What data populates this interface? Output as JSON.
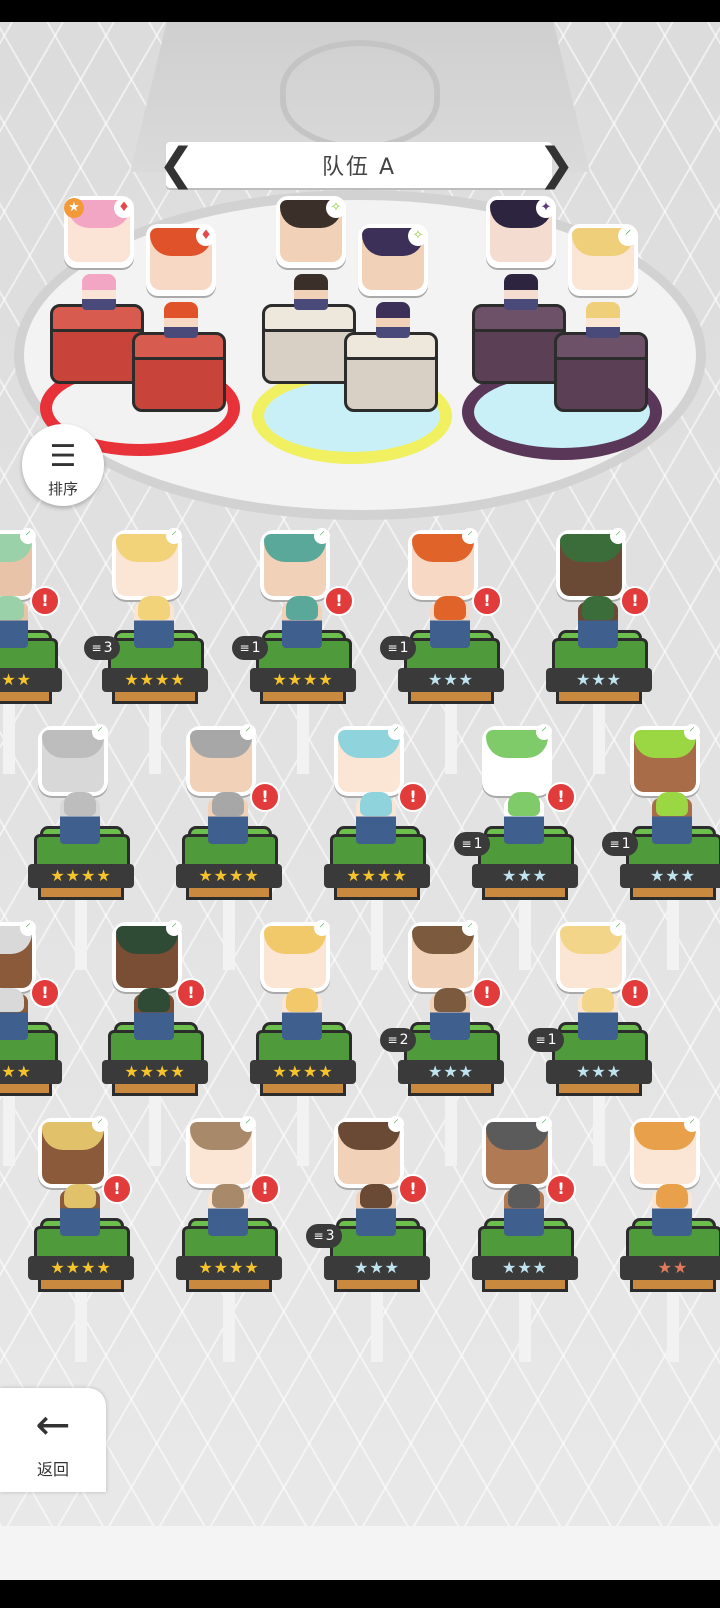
{
  "header": {
    "team_label": "队伍 A"
  },
  "buttons": {
    "sort_label": "排序",
    "back_label": "返回"
  },
  "colors": {
    "gold": "#f7c32a",
    "silver": "#bfe3ef",
    "bronze": "#e07a5a",
    "alert": "#e23b3b",
    "grass": "#4f9a3a"
  },
  "team_slots": [
    {
      "ring": "red",
      "members": [
        {
          "hair": "#f3a6c4",
          "skin": "#fbe3d6",
          "suit": "♦",
          "suit_color": "#e24b4b",
          "rank": "★"
        },
        {
          "hair": "#e0532a",
          "skin": "#f7d8c4",
          "suit": "♦",
          "suit_color": "#e24b4b"
        }
      ]
    },
    {
      "ring": "yellow",
      "members": [
        {
          "hair": "#3b2f29",
          "skin": "#f1d2b9",
          "suit": "✧",
          "suit_color": "#8fc93a"
        },
        {
          "hair": "#3c2f58",
          "skin": "#f1d2b9",
          "suit": "✧",
          "suit_color": "#8fc93a"
        }
      ]
    },
    {
      "ring": "purple",
      "members": [
        {
          "hair": "#2d2440",
          "skin": "#f4dcd0",
          "suit": "✦",
          "suit_color": "#5b3b7e"
        },
        {
          "hair": "#f0cf7b",
          "skin": "#fbe6d6",
          "suit": "⸍",
          "suit_color": "#3aa64b"
        }
      ]
    }
  ],
  "units": [
    {
      "hair": "#9ad1a8",
      "skin": "#e8c3a7",
      "stars": "★★★",
      "tier": "gold",
      "alert": true,
      "badge": ""
    },
    {
      "hair": "#f2d37a",
      "skin": "#fbe6d6",
      "stars": "★★★★",
      "tier": "gold",
      "alert": false,
      "badge": "3"
    },
    {
      "hair": "#5aa89a",
      "skin": "#f1d2b9",
      "stars": "★★★★",
      "tier": "gold",
      "alert": true,
      "badge": "1"
    },
    {
      "hair": "#e0642a",
      "skin": "#f7d8c4",
      "stars": "★★★",
      "tier": "silver",
      "alert": true,
      "badge": "1"
    },
    {
      "hair": "#3b6d3a",
      "skin": "#6b4a35",
      "stars": "★★★",
      "tier": "silver",
      "alert": true,
      "badge": ""
    },
    {
      "hair": "#bdbdbd",
      "skin": "#d8d8d8",
      "stars": "★★★★",
      "tier": "gold",
      "alert": false,
      "badge": ""
    },
    {
      "hair": "#a7a7a7",
      "skin": "#f1d2b9",
      "stars": "★★★★",
      "tier": "gold",
      "alert": true,
      "badge": ""
    },
    {
      "hair": "#8fd3dd",
      "skin": "#fbe6d6",
      "stars": "★★★★",
      "tier": "gold",
      "alert": true,
      "badge": ""
    },
    {
      "hair": "#7fcb6a",
      "skin": "#ffffff",
      "stars": "★★★",
      "tier": "silver",
      "alert": true,
      "badge": "1"
    },
    {
      "hair": "#9bd743",
      "skin": "#a86c48",
      "stars": "★★★",
      "tier": "silver",
      "alert": false,
      "badge": "1"
    },
    {
      "hair": "#d9d9d9",
      "skin": "#8a5a3a",
      "stars": "★★★",
      "tier": "gold",
      "alert": true,
      "badge": ""
    },
    {
      "hair": "#2f4a35",
      "skin": "#7a4d35",
      "stars": "★★★★",
      "tier": "gold",
      "alert": true,
      "badge": ""
    },
    {
      "hair": "#f2c96a",
      "skin": "#fbe6d6",
      "stars": "★★★★",
      "tier": "gold",
      "alert": false,
      "badge": ""
    },
    {
      "hair": "#7b5a3d",
      "skin": "#f1d2b9",
      "stars": "★★★",
      "tier": "silver",
      "alert": true,
      "badge": "2"
    },
    {
      "hair": "#f3d58a",
      "skin": "#fbe6d6",
      "stars": "★★★",
      "tier": "silver",
      "alert": true,
      "badge": "1"
    },
    {
      "hair": "#e2c16b",
      "skin": "#8a5a3a",
      "stars": "★★★★",
      "tier": "gold",
      "alert": true,
      "badge": ""
    },
    {
      "hair": "#a8896a",
      "skin": "#fbe6d6",
      "stars": "★★★★",
      "tier": "gold",
      "alert": true,
      "badge": ""
    },
    {
      "hair": "#6a4a35",
      "skin": "#f1d2b9",
      "stars": "★★★",
      "tier": "silver",
      "alert": true,
      "badge": "3"
    },
    {
      "hair": "#5b5b5b",
      "skin": "#b07a55",
      "stars": "★★★",
      "tier": "silver",
      "alert": true,
      "badge": ""
    },
    {
      "hair": "#e8a04a",
      "skin": "#fbe6d6",
      "stars": "★★",
      "tier": "bronze",
      "alert": false,
      "badge": ""
    }
  ]
}
